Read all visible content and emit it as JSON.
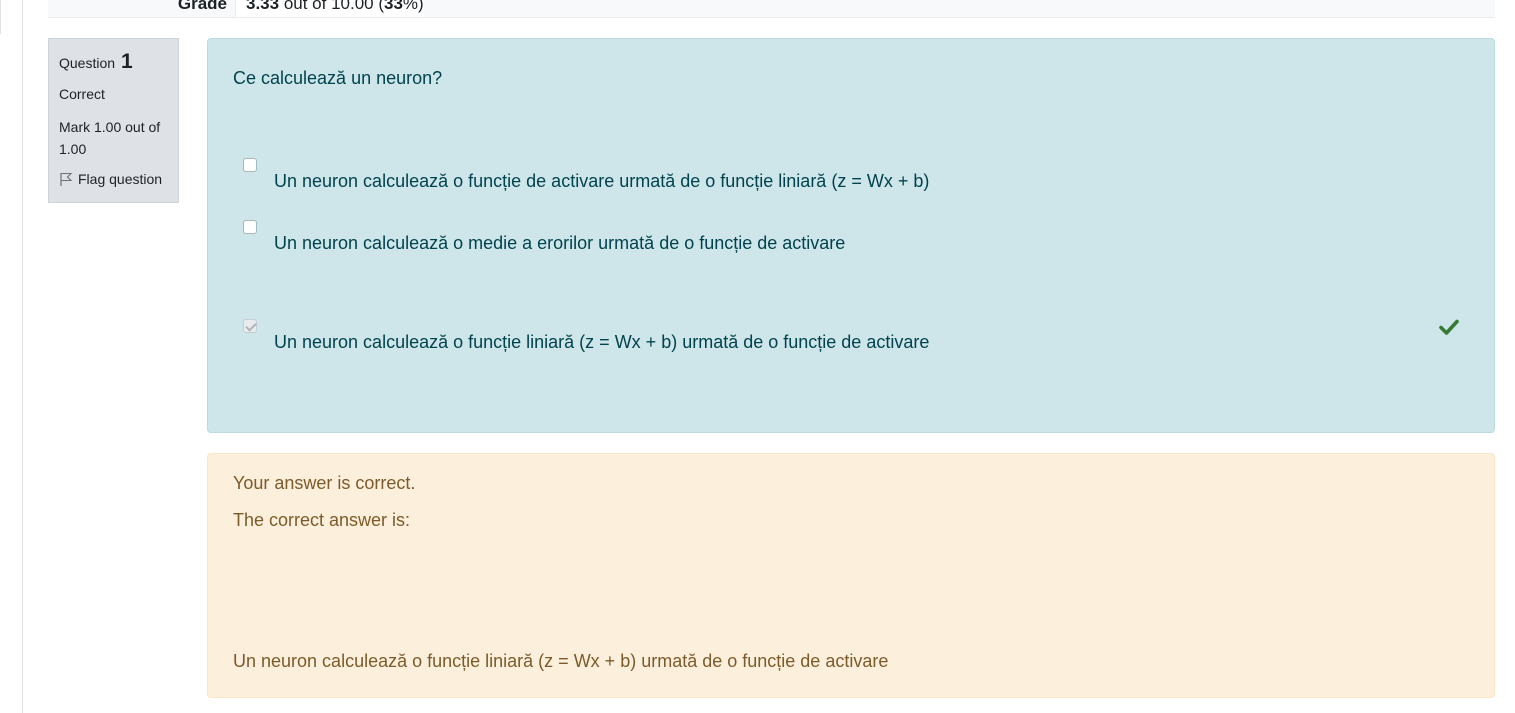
{
  "grade": {
    "label": "Grade",
    "score": "3.33",
    "out_of_text": " out of 10.00 (",
    "percent": "33",
    "percent_suffix": "%)"
  },
  "question_info": {
    "question_word": "Question",
    "number": "1",
    "state": "Correct",
    "mark": "Mark 1.00 out of 1.00",
    "flag_label": "Flag question"
  },
  "question": {
    "text": "Ce calculează un neuron?",
    "options": [
      {
        "label": "Un neuron calculează o funcție de activare urmată de o funcție liniară (z = Wx + b)",
        "checked": false
      },
      {
        "label": "Un neuron calculează o medie a erorilor urmată de o funcție de activare",
        "checked": false
      },
      {
        "label": "Un neuron calculează o funcție liniară (z = Wx + b) urmată de o funcție de activare",
        "checked": true
      }
    ],
    "correct_icon": "check-icon",
    "correct_color": "#357a32"
  },
  "feedback": {
    "your_answer": "Your answer is correct.",
    "correct_intro": "The correct answer is:",
    "correct_answer": "Un neuron calculează o funcție liniară (z = Wx + b) urmată de o funcție de activare"
  },
  "colors": {
    "formulation_bg": "#cee6ea",
    "formulation_text": "#00434e",
    "feedback_bg": "#fcefdc",
    "feedback_text": "#7d5a29",
    "info_bg": "#dee2e6"
  }
}
